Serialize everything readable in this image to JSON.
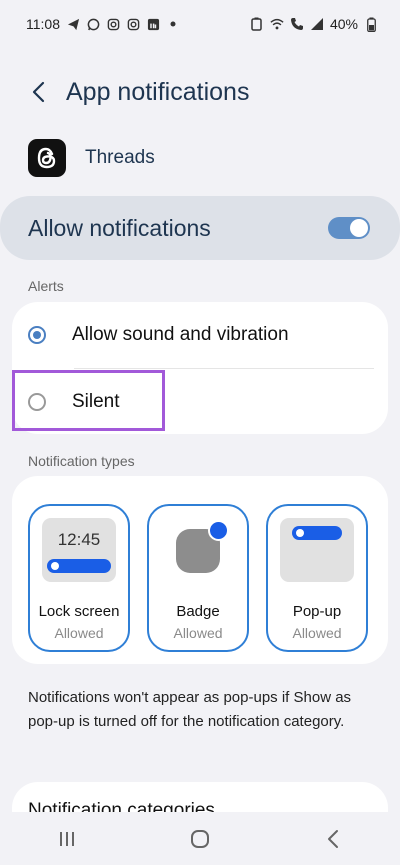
{
  "status_bar": {
    "time": "11:08",
    "battery": "40%",
    "left_icons": [
      "telegram-icon",
      "whatsapp-icon",
      "instagram-icon",
      "instagram-icon",
      "linkedin-icon",
      "dot-icon"
    ],
    "right_icons": [
      "battery-saver-icon",
      "wifi-icon",
      "call-icon",
      "signal-icon",
      "battery-icon"
    ]
  },
  "header": {
    "title": "App notifications"
  },
  "app": {
    "name": "Threads"
  },
  "allow": {
    "label": "Allow notifications",
    "enabled": true
  },
  "alerts": {
    "section_label": "Alerts",
    "options": [
      {
        "label": "Allow sound and vibration",
        "selected": true
      },
      {
        "label": "Silent",
        "selected": false
      }
    ]
  },
  "types": {
    "section_label": "Notification types",
    "items": [
      {
        "title": "Lock screen",
        "status": "Allowed",
        "preview_time": "12:45"
      },
      {
        "title": "Badge",
        "status": "Allowed"
      },
      {
        "title": "Pop-up",
        "status": "Allowed"
      }
    ]
  },
  "info": {
    "text": "Notifications won't appear as pop-ups if Show as pop-up is turned off for the notification category."
  },
  "categories": {
    "label": "Notification categories"
  },
  "nav": {
    "buttons": [
      "recents-icon",
      "home-icon",
      "back-icon"
    ]
  },
  "colors": {
    "accent": "#4a7fc1",
    "tile_border": "#2f7fd6",
    "highlight": "#a259d9",
    "title": "#1e3550"
  }
}
